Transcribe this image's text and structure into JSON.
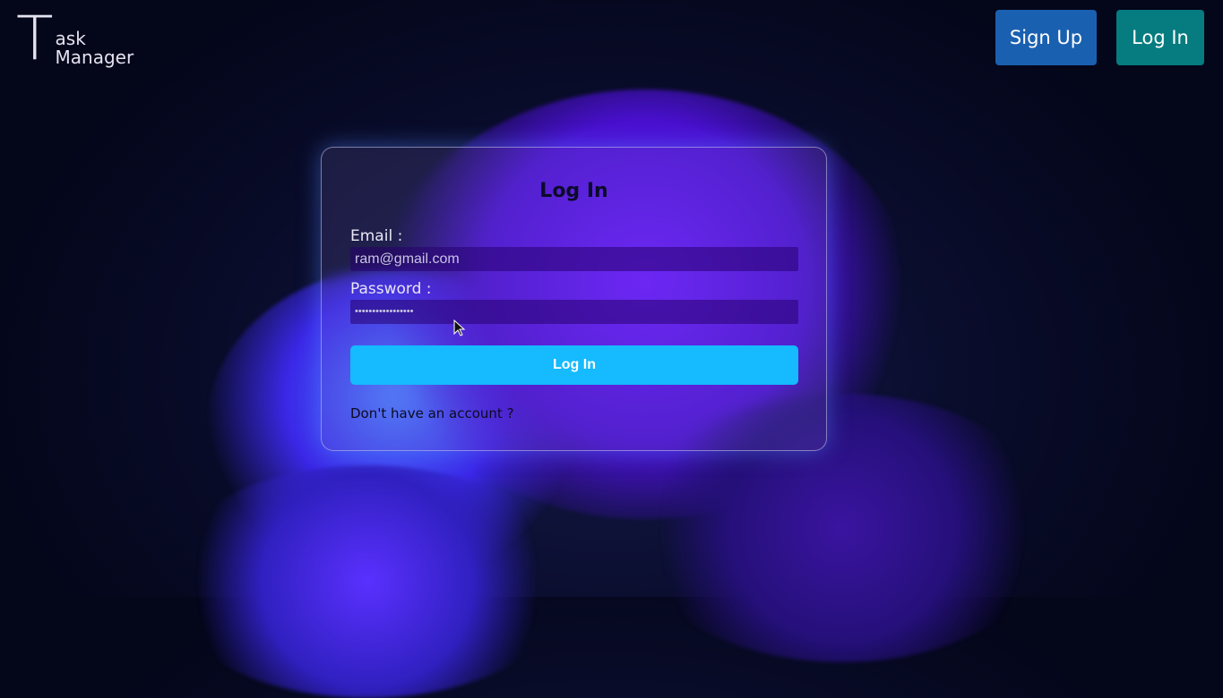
{
  "logo": {
    "letter": "T",
    "line1": "ask",
    "line2": "Manager"
  },
  "nav": {
    "signup": "Sign Up",
    "login": "Log In"
  },
  "form": {
    "title": "Log In",
    "email_label": "Email :",
    "email_value": "ram@gmail.com",
    "password_label": "Password :",
    "password_value": "•••••••••••••••••",
    "submit": "Log In",
    "signup_link": "Don't have an account ?"
  }
}
